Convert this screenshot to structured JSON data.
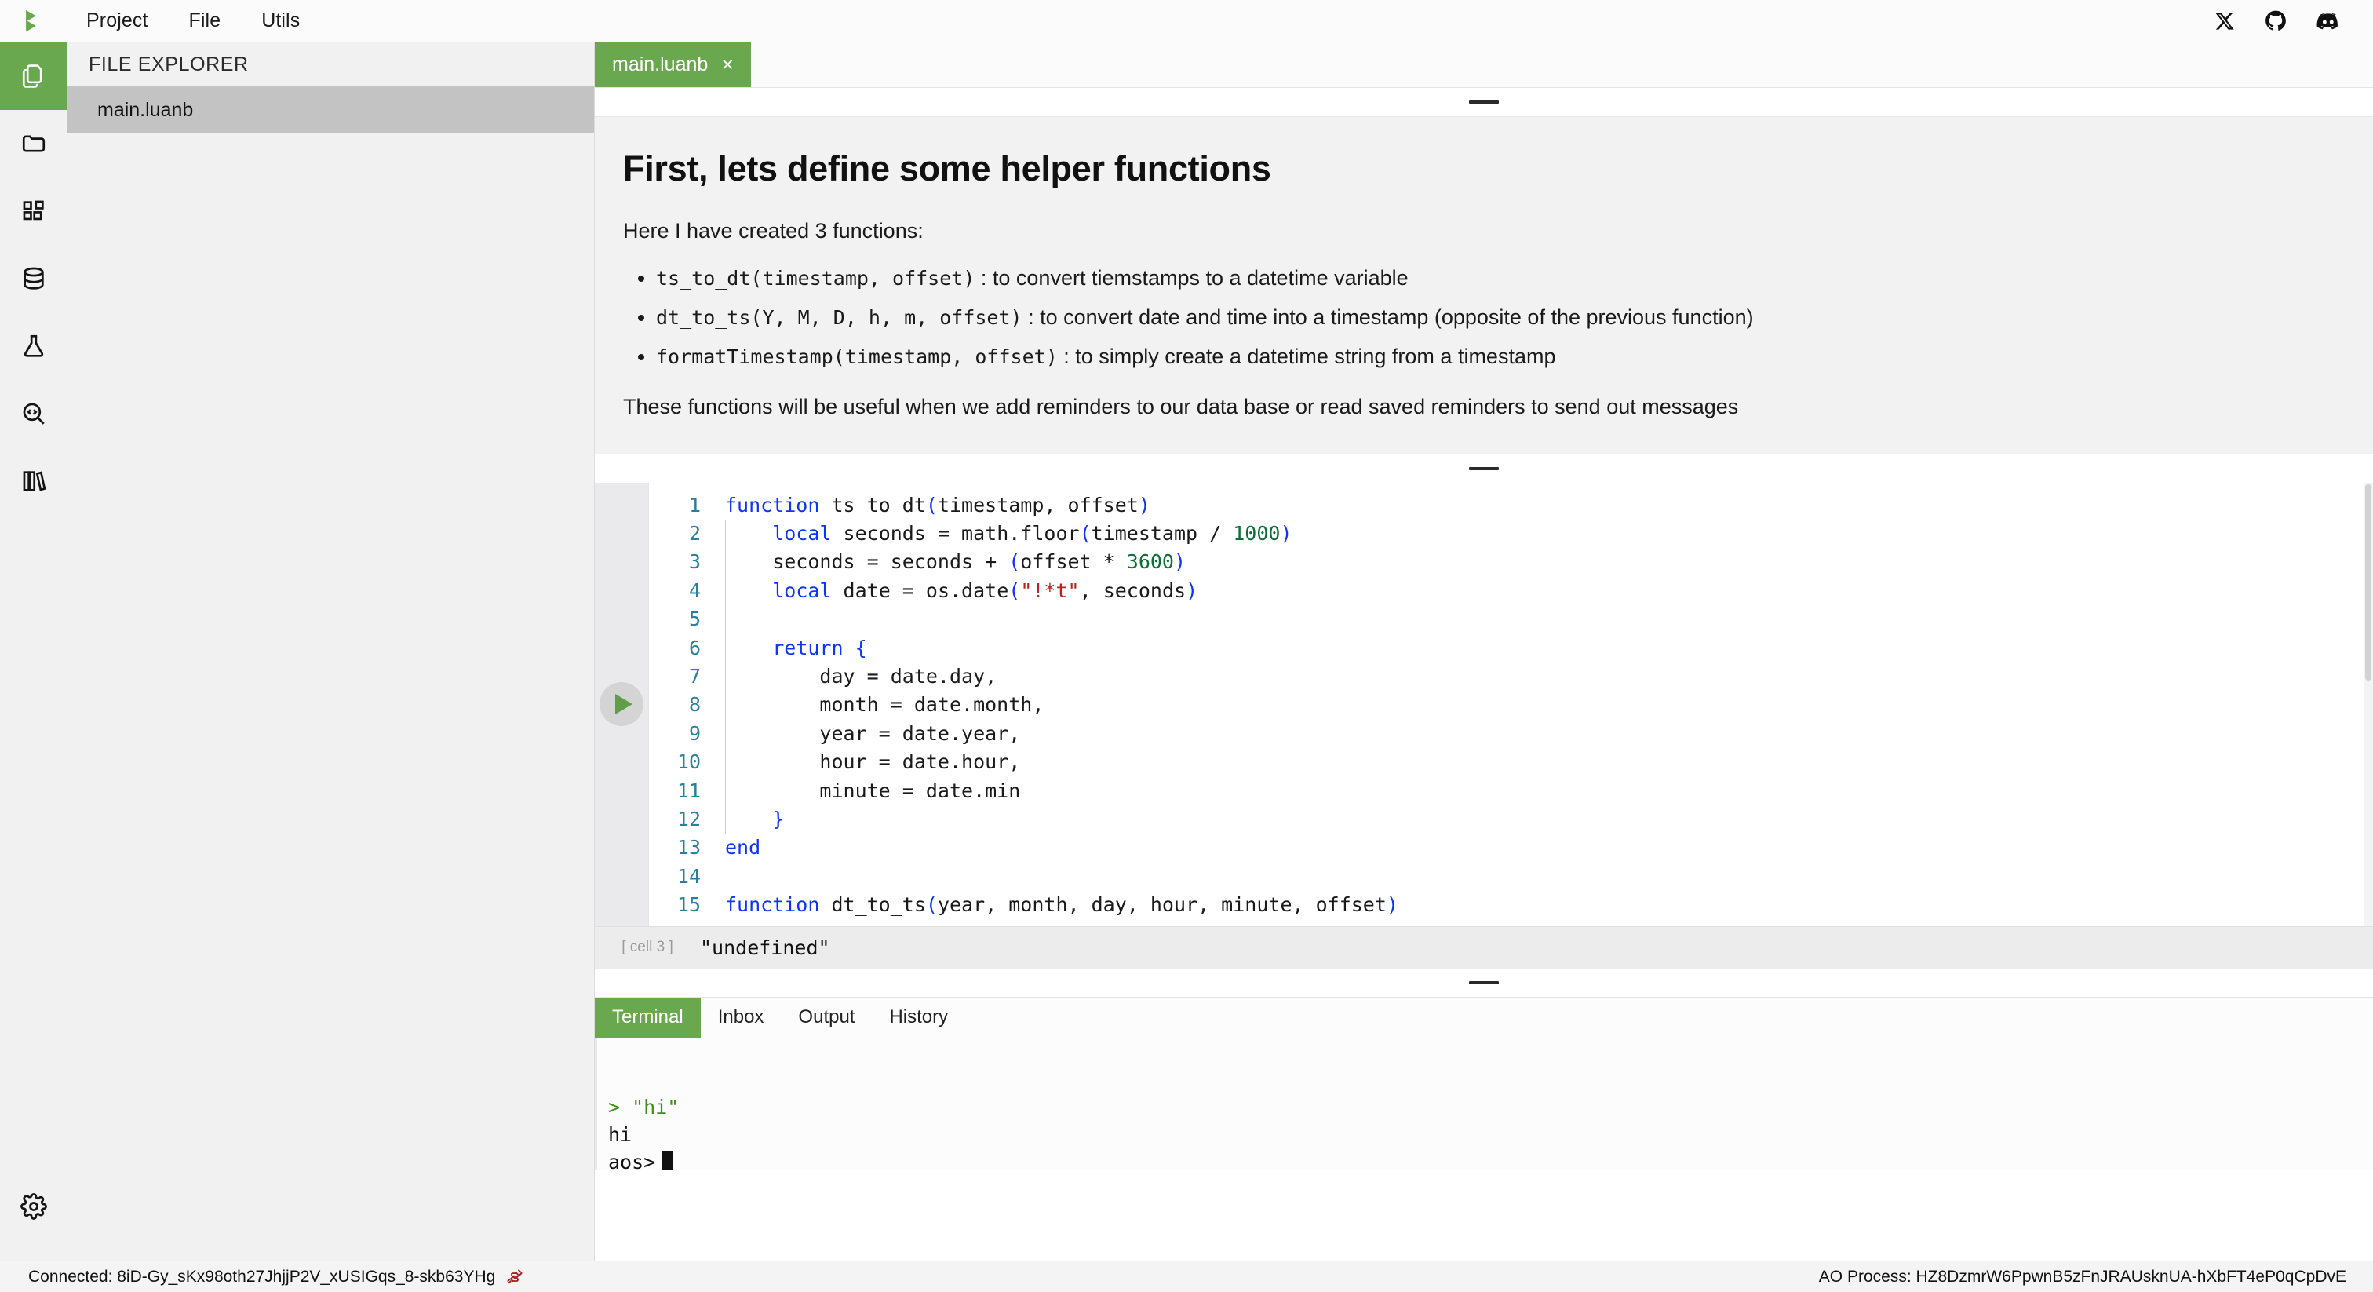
{
  "menubar": {
    "logo_icon": "play-logo-icon",
    "items": [
      {
        "label": "Project"
      },
      {
        "label": "File"
      },
      {
        "label": "Utils"
      }
    ],
    "social": [
      {
        "icon": "x-twitter-icon"
      },
      {
        "icon": "github-icon"
      },
      {
        "icon": "discord-icon"
      }
    ]
  },
  "rail": {
    "items": [
      {
        "icon": "files-icon",
        "active": true
      },
      {
        "icon": "folder-icon",
        "active": false
      },
      {
        "icon": "blocks-icon",
        "active": false
      },
      {
        "icon": "database-icon",
        "active": false
      },
      {
        "icon": "flask-icon",
        "active": false
      },
      {
        "icon": "code-search-icon",
        "active": false
      },
      {
        "icon": "library-icon",
        "active": false
      }
    ],
    "settings": {
      "icon": "gear-icon"
    }
  },
  "explorer": {
    "title": "FILE EXPLORER",
    "files": [
      {
        "name": "main.luanb",
        "selected": true
      }
    ]
  },
  "tabs": [
    {
      "label": "main.luanb",
      "close": "×",
      "active": true
    }
  ],
  "markdown_cell": {
    "heading": "First, lets define some helper functions",
    "intro": "Here I have created 3 functions:",
    "bullets": [
      {
        "code": "ts_to_dt(timestamp, offset)",
        "text": " : to convert tiemstamps to a datetime variable"
      },
      {
        "code": "dt_to_ts(Y, M, D, h, m, offset)",
        "text": " : to convert date and time into a timestamp (opposite of the previous function)"
      },
      {
        "code": "formatTimestamp(timestamp, offset)",
        "text": " : to simply create a datetime string from a timestamp"
      }
    ],
    "closing": "These functions will be useful when we add reminders to our data base or read saved reminders to send out messages"
  },
  "code_cell": {
    "run_button_icon": "play-icon",
    "lines": [
      {
        "n": "1",
        "tokens": [
          {
            "t": "function ",
            "c": "kw"
          },
          {
            "t": "ts_to_dt",
            "c": ""
          },
          {
            "t": "(",
            "c": "paren"
          },
          {
            "t": "timestamp, offset",
            "c": ""
          },
          {
            "t": ")",
            "c": "paren"
          }
        ],
        "indent": 0
      },
      {
        "n": "2",
        "tokens": [
          {
            "t": "    ",
            "c": ""
          },
          {
            "t": "local",
            "c": "kw"
          },
          {
            "t": " seconds = math.floor",
            "c": ""
          },
          {
            "t": "(",
            "c": "paren"
          },
          {
            "t": "timestamp / ",
            "c": ""
          },
          {
            "t": "1000",
            "c": "num"
          },
          {
            "t": ")",
            "c": "paren"
          }
        ],
        "indent": 1
      },
      {
        "n": "3",
        "tokens": [
          {
            "t": "    seconds = seconds + ",
            "c": ""
          },
          {
            "t": "(",
            "c": "paren"
          },
          {
            "t": "offset * ",
            "c": ""
          },
          {
            "t": "3600",
            "c": "num"
          },
          {
            "t": ")",
            "c": "paren"
          }
        ],
        "indent": 1
      },
      {
        "n": "4",
        "tokens": [
          {
            "t": "    ",
            "c": ""
          },
          {
            "t": "local",
            "c": "kw"
          },
          {
            "t": " date = os.date",
            "c": ""
          },
          {
            "t": "(",
            "c": "paren"
          },
          {
            "t": "\"!*t\"",
            "c": "str"
          },
          {
            "t": ", seconds",
            "c": ""
          },
          {
            "t": ")",
            "c": "paren"
          }
        ],
        "indent": 1
      },
      {
        "n": "5",
        "tokens": [],
        "indent": 1
      },
      {
        "n": "6",
        "tokens": [
          {
            "t": "    ",
            "c": ""
          },
          {
            "t": "return",
            "c": "kw"
          },
          {
            "t": " ",
            "c": ""
          },
          {
            "t": "{",
            "c": "paren"
          }
        ],
        "indent": 1
      },
      {
        "n": "7",
        "tokens": [
          {
            "t": "        day = date.day,",
            "c": ""
          }
        ],
        "indent": 2
      },
      {
        "n": "8",
        "tokens": [
          {
            "t": "        month = date.month,",
            "c": ""
          }
        ],
        "indent": 2
      },
      {
        "n": "9",
        "tokens": [
          {
            "t": "        year = date.year,",
            "c": ""
          }
        ],
        "indent": 2
      },
      {
        "n": "10",
        "tokens": [
          {
            "t": "        hour = date.hour,",
            "c": ""
          }
        ],
        "indent": 2
      },
      {
        "n": "11",
        "tokens": [
          {
            "t": "        minute = date.min",
            "c": ""
          }
        ],
        "indent": 2
      },
      {
        "n": "12",
        "tokens": [
          {
            "t": "    ",
            "c": ""
          },
          {
            "t": "}",
            "c": "paren"
          }
        ],
        "indent": 1
      },
      {
        "n": "13",
        "tokens": [
          {
            "t": "end",
            "c": "kw"
          }
        ],
        "indent": 0
      },
      {
        "n": "14",
        "tokens": [],
        "indent": 0
      },
      {
        "n": "15",
        "tokens": [
          {
            "t": "function ",
            "c": "kw"
          },
          {
            "t": "dt_to_ts",
            "c": ""
          },
          {
            "t": "(",
            "c": "paren"
          },
          {
            "t": "year, month, day, hour, minute, offset",
            "c": ""
          },
          {
            "t": ")",
            "c": "paren"
          }
        ],
        "indent": 0
      }
    ],
    "output": {
      "tag": "[ cell 3 ]",
      "value": "\"undefined\""
    }
  },
  "bottom_panel": {
    "tabs": [
      {
        "label": "Terminal",
        "active": true
      },
      {
        "label": "Inbox",
        "active": false
      },
      {
        "label": "Output",
        "active": false
      },
      {
        "label": "History",
        "active": false
      }
    ],
    "terminal_lines": [
      {
        "text": "> \"hi\"",
        "kind": "cmd"
      },
      {
        "text": "hi",
        "kind": "out"
      }
    ],
    "prompt": "aos>"
  },
  "statusbar": {
    "connection": "Connected: 8iD-Gy_sKx98oth27JhjjP2V_xUSIGqs_8-skb63YHg",
    "plug_icon": "unplug-icon",
    "process": "AO Process: HZ8DzmrW6PpwnB5zFnJRAUsknUA-hXbFT4eP0qCpDvE"
  },
  "colors": {
    "accent_green": "#6aa84f",
    "keyword_blue": "#0d35f5",
    "number_green": "#0c7036",
    "string_red": "#b3261e",
    "linenum_blue": "#2a7f9e"
  }
}
